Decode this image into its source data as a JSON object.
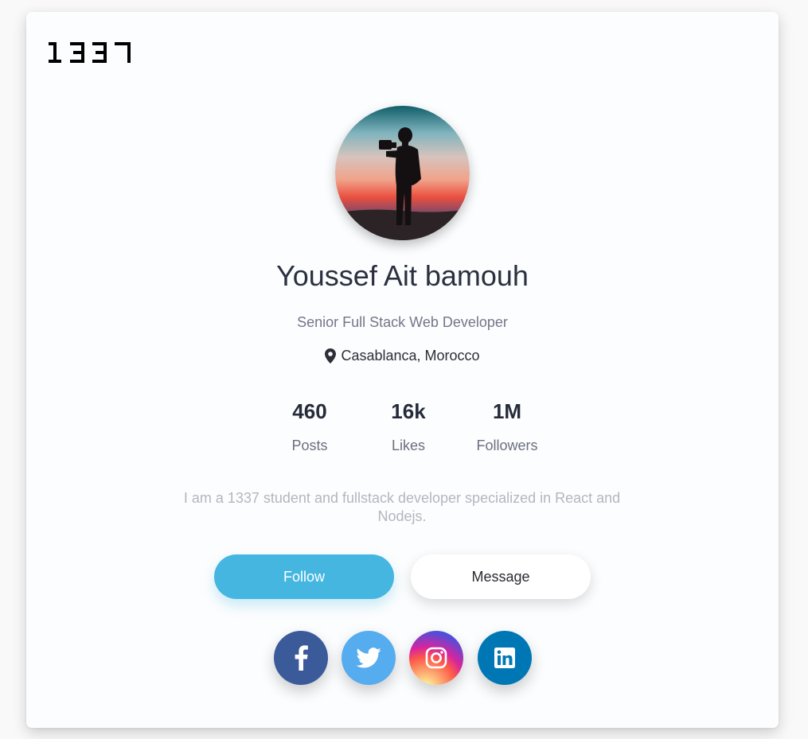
{
  "logo": {
    "text": "1337"
  },
  "profile": {
    "name": "Youssef Ait bamouh",
    "title": "Senior Full Stack Web Developer",
    "location": "Casablanca, Morocco",
    "location_icon": "map-pin-icon",
    "avatar_icon": "photographer-silhouette-avatar"
  },
  "stats": [
    {
      "value": "460",
      "label": "Posts"
    },
    {
      "value": "16k",
      "label": "Likes"
    },
    {
      "value": "1M",
      "label": "Followers"
    }
  ],
  "bio": "I am a 1337 student and fullstack developer specialized in React and Nodejs.",
  "actions": {
    "follow_label": "Follow",
    "message_label": "Message"
  },
  "social": [
    {
      "name": "facebook-icon",
      "color": "#3b5a9a"
    },
    {
      "name": "twitter-icon",
      "color": "#55acee"
    },
    {
      "name": "instagram-icon",
      "color": "#d6249f"
    },
    {
      "name": "linkedin-icon",
      "color": "#0077b5"
    }
  ],
  "colors": {
    "accent": "#44b6e0",
    "name_text": "#2b3040",
    "subtitle_text": "#77748a",
    "bio_text": "#b4b6bf"
  }
}
